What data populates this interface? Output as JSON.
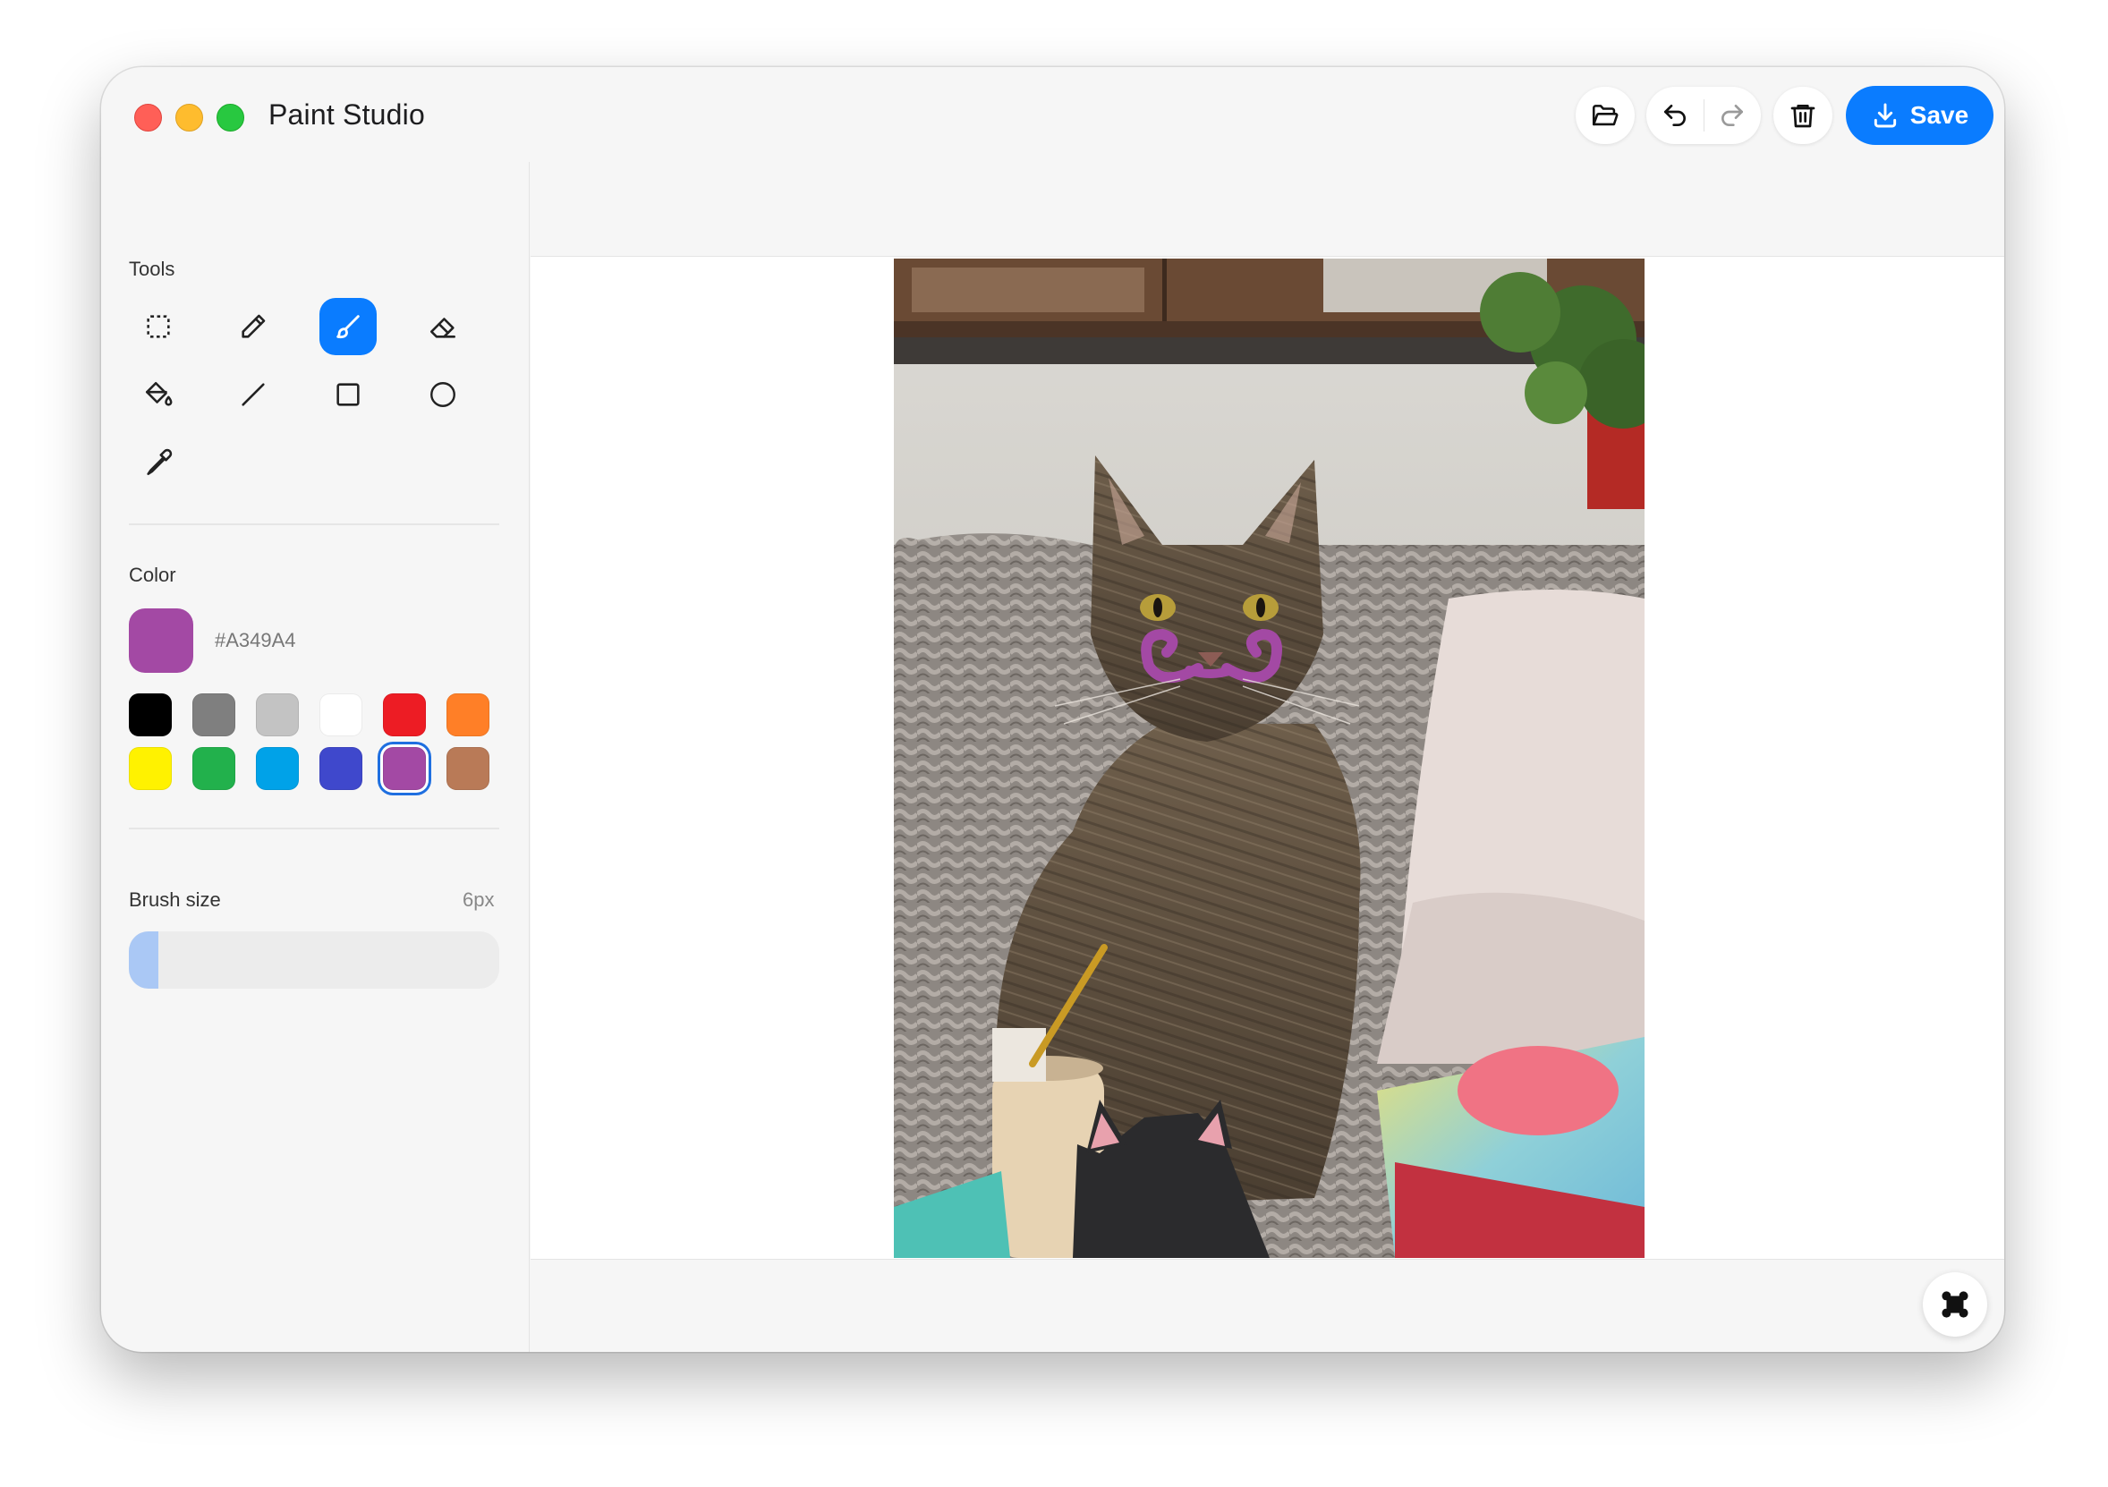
{
  "window": {
    "title": "Paint Studio"
  },
  "toolbar": {
    "open_icon": "folder-open-icon",
    "undo_icon": "undo-icon",
    "redo_icon": "redo-icon",
    "clear_icon": "trash-icon",
    "save_label": "Save",
    "save_icon": "download-icon"
  },
  "sidebar": {
    "tools_label": "Tools",
    "tools": [
      {
        "id": "select",
        "icon": "dashed-rectangle-select-icon"
      },
      {
        "id": "pencil",
        "icon": "pencil-icon"
      },
      {
        "id": "brush",
        "icon": "brush-icon",
        "active": true
      },
      {
        "id": "eraser",
        "icon": "eraser-icon"
      },
      {
        "id": "fill",
        "icon": "paint-bucket-icon"
      },
      {
        "id": "line",
        "icon": "line-icon"
      },
      {
        "id": "rectangle",
        "icon": "rectangle-icon"
      },
      {
        "id": "ellipse",
        "icon": "circle-icon"
      },
      {
        "id": "eyedropper",
        "icon": "eyedropper-icon"
      }
    ],
    "color_label": "Color",
    "current_color": "#A349A4",
    "current_color_label": "#A349A4",
    "palette": [
      "#000000",
      "#7f7f7f",
      "#c3c3c3",
      "#ffffff",
      "#ed1c24",
      "#ff7f27",
      "#fff200",
      "#22b14c",
      "#00a2e8",
      "#3f48cc",
      "#a349a4",
      "#b97a57"
    ],
    "selected_palette_index": 10,
    "brush_size_label": "Brush size",
    "brush_size_value": "6px",
    "brush_size_fraction": 0.05
  },
  "canvas": {
    "image": "photo of tabby cat with drawn purple mustache",
    "fab_icon": "fit-to-screen-icon"
  }
}
